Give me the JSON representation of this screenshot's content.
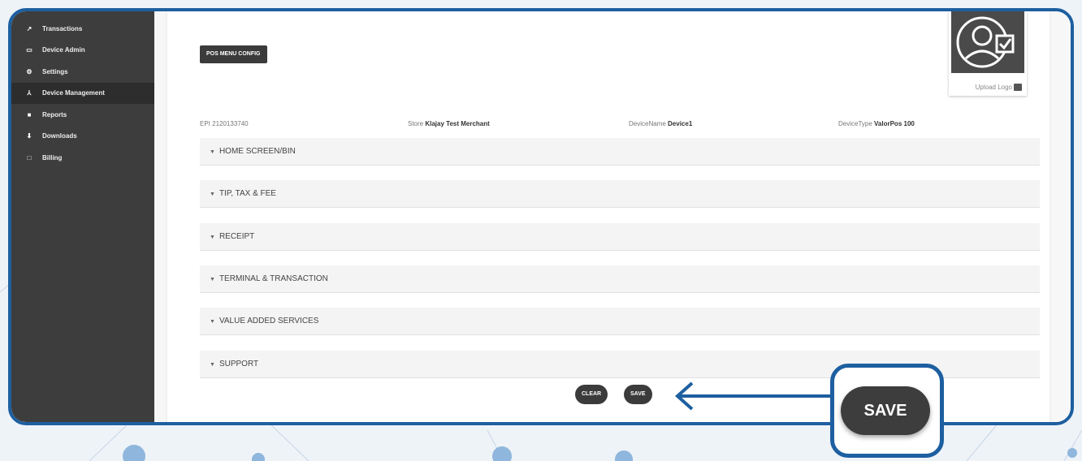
{
  "sidebar": {
    "items": [
      {
        "icon": "chart-line-icon",
        "glyph": "↗",
        "label": "Transactions"
      },
      {
        "icon": "device-icon",
        "glyph": "▭",
        "label": "Device Admin"
      },
      {
        "icon": "gear-icon",
        "glyph": "⚙",
        "label": "Settings"
      },
      {
        "icon": "network-icon",
        "glyph": "⅄",
        "label": "Device Management"
      },
      {
        "icon": "document-icon",
        "glyph": "■",
        "label": "Reports"
      },
      {
        "icon": "download-icon",
        "glyph": "⬇",
        "label": "Downloads"
      },
      {
        "icon": "billing-icon",
        "glyph": "□",
        "label": "Billing"
      }
    ],
    "active_index": 3
  },
  "main": {
    "pos_menu_button": "POS MENU CONFIG",
    "upload_logo": "Upload Logo",
    "info": {
      "epi": "EPI 2120133740",
      "store_label": "Store",
      "store_value": "Klajay Test Merchant",
      "device_name_label": "DeviceName",
      "device_name_value": "Device1",
      "device_type_label": "DeviceType",
      "device_type_value": "ValorPos 100"
    },
    "sections": [
      "HOME SCREEN/BIN",
      "TIP, TAX & FEE",
      "RECEIPT",
      "TERMINAL & TRANSACTION",
      "VALUE ADDED SERVICES",
      "SUPPORT"
    ],
    "clear_button": "CLEAR",
    "save_button": "SAVE"
  },
  "callout": {
    "save_label": "SAVE"
  },
  "colors": {
    "frame_border": "#1d5fa0",
    "sidebar_bg": "#3d3d3d",
    "button_bg": "#3b3b3b"
  }
}
